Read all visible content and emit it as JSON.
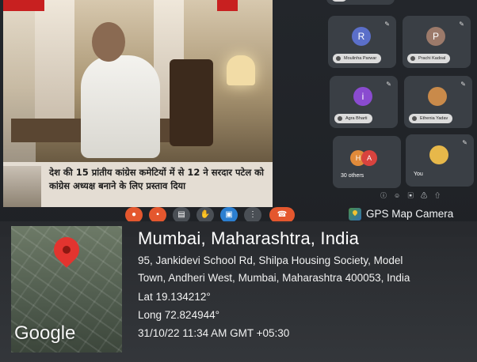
{
  "presentation": {
    "caption": "देश की 15 प्रांतीय कांग्रेस कमेटियों में से 12 ने सरदार पटेल को कांग्रेस अध्यक्ष बनाने के लिए प्रस्ताव दिया"
  },
  "participants": [
    {
      "initial": "R",
      "name": "Moulinha Parwar",
      "color": "#5b6fc9"
    },
    {
      "initial": "P",
      "name": "Prachi Kadoal",
      "color": "#9c7a6a"
    },
    {
      "initial": "i",
      "name": "Agra Bharti",
      "color": "#8a4bd0"
    },
    {
      "initial": "",
      "name": "Ethenia Yadav",
      "color": "#c98a4a"
    }
  ],
  "others": {
    "label": "30 others",
    "initials": [
      "H",
      "A"
    ]
  },
  "self_tile": {
    "label": "You"
  },
  "gps": {
    "brand": "GPS Map Camera",
    "title": "Mumbai, Maharashtra, India",
    "address_line1": "95, Jankidevi School Rd, Shilpa Housing Society, Model",
    "address_line2": "Town, Andheri West, Mumbai, Maharashtra 400053, India",
    "lat": "Lat 19.134212°",
    "long": "Long 72.824944°",
    "datetime": "31/10/22 11:34 AM GMT +05:30",
    "map_logo": "Google"
  },
  "colors": {
    "hangup": "#e4572e",
    "pin": "#e3342f",
    "present": "#2b7fd1"
  }
}
